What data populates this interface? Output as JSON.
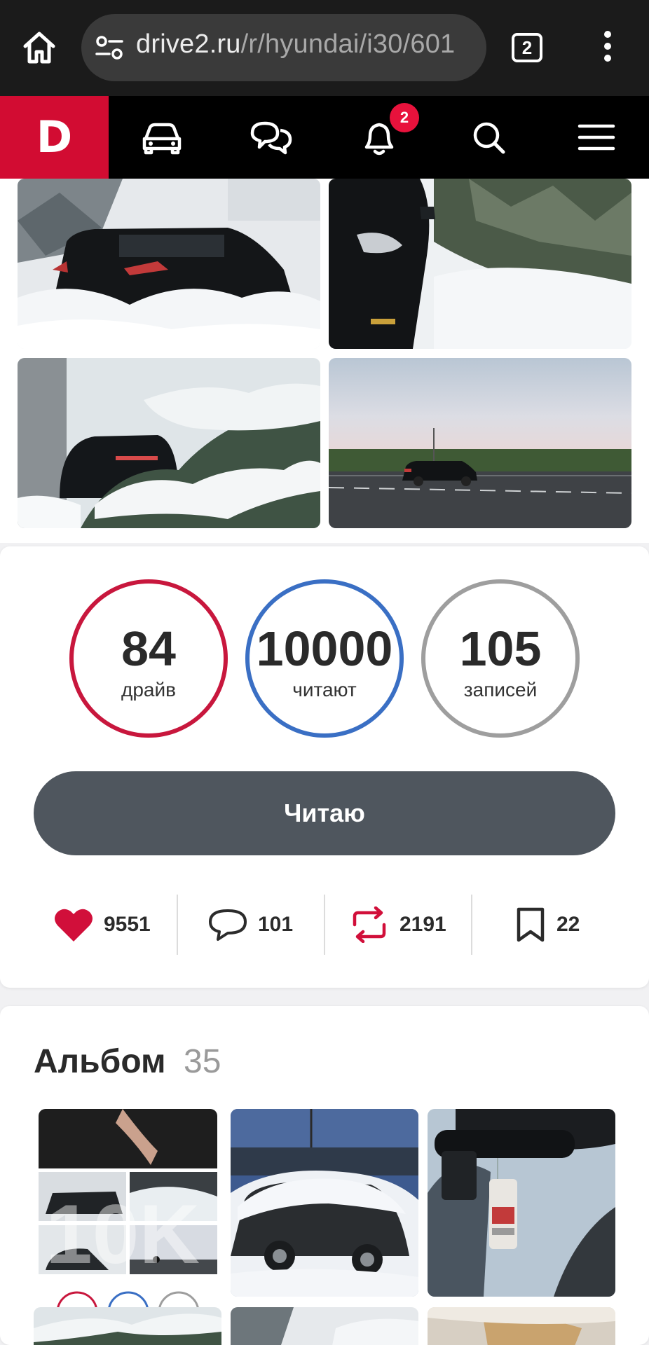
{
  "browser": {
    "url_domain": "drive2.ru",
    "url_path": "/r/hyundai/i30/601",
    "tab_count": "2"
  },
  "site_nav": {
    "logo_letter": "D",
    "notification_count": "2"
  },
  "stats": {
    "drive": {
      "value": "84",
      "label": "драйв",
      "color": "#c8173d"
    },
    "readers": {
      "value": "10000",
      "label": "читают",
      "color": "#3a6fc4"
    },
    "posts": {
      "value": "105",
      "label": "записей",
      "color": "#9e9e9e"
    }
  },
  "read_button": {
    "label": "Читаю"
  },
  "actions": {
    "likes": "9551",
    "comments": "101",
    "reposts": "2191",
    "bookmarks": "22"
  },
  "album": {
    "title": "Альбом",
    "count": "35",
    "collage_overlay_text": "10K"
  },
  "colors": {
    "brand_red": "#d20c32",
    "like_red": "#d10f3a",
    "button_gray": "#4f565e"
  }
}
